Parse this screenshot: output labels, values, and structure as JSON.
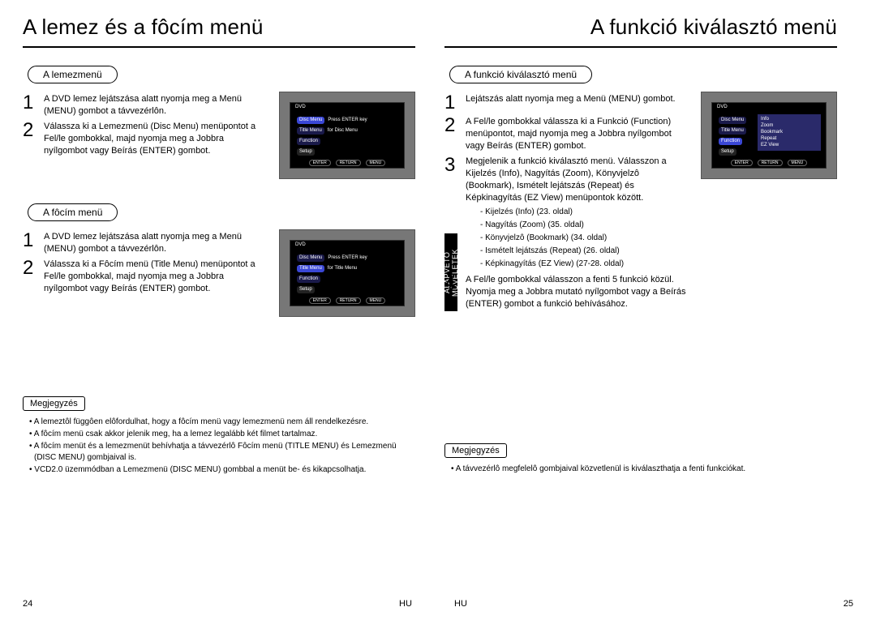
{
  "left": {
    "title": "A lemez és a fôcím menü",
    "discMenu": {
      "label": "A lemezmenü",
      "steps": [
        "A DVD lemez lejátszása alatt nyomja meg a Menü (MENU) gombot a távvezérlôn.",
        "Válassza ki a Lemezmenü (Disc Menu) menüpontot a Fel/le gombokkal, majd nyomja meg a Jobbra nyílgombot vagy Beírás (ENTER) gombot."
      ]
    },
    "titleMenu": {
      "label": "A fôcím menü",
      "steps": [
        "A DVD lemez lejátszása alatt nyomja meg a Menü (MENU) gombot a távvezérlôn.",
        "Válassza ki a Fôcím menü (Title Menu) menüpontot a Fel/le gombokkal, majd nyomja meg a Jobbra nyílgombot vagy Beírás (ENTER) gombot."
      ]
    },
    "osd1": {
      "title": "DVD",
      "items": [
        "Disc Menu",
        "Title Menu",
        "Function",
        "Setup"
      ],
      "hint1": "Press ENTER key",
      "hint2": "for Disc Menu",
      "btns": [
        "ENTER",
        "RETURN",
        "MENU"
      ]
    },
    "osd2": {
      "title": "DVD",
      "items": [
        "Disc Menu",
        "Title Menu",
        "Function",
        "Setup"
      ],
      "hint1": "Press ENTER key",
      "hint2": "for Title Menu",
      "btns": [
        "ENTER",
        "RETURN",
        "MENU"
      ]
    },
    "noteLabel": "Megjegyzés",
    "notes": [
      "• A lemeztôl függôen elôfordulhat, hogy a fôcím menü vagy lemezmenü nem áll rendelkezésre.",
      "• A fôcím menü csak akkor jelenik meg, ha a lemez legalább két filmet tartalmaz.",
      "• A fôcím menüt és a lemezmenüt behívhatja a távvezérlô Fôcím menü (TITLE MENU) és Lemezmenü (DISC MENU) gombjaival is.",
      "• VCD2.0 üzemmódban a Lemezmenü (DISC MENU) gombbal a menüt be- és kikapcsolhatja."
    ],
    "pageNum": "24",
    "lang": "HU"
  },
  "right": {
    "title": "A funkció kiválasztó menü",
    "section": {
      "label": "A funkció kiválasztó menü",
      "steps": [
        "Lejátszás alatt nyomja meg a Menü (MENU) gombot.",
        "A Fel/le gombokkal válassza ki a Funkció (Function) menüpontot, majd nyomja meg a Jobbra nyílgombot vagy Beírás (ENTER) gombot.",
        "Megjelenik a funkció kiválasztó menü. Válasszon a Kijelzés (Info), Nagyítás (Zoom), Könyvjelzô (Bookmark), Ismételt lejátszás (Repeat) és Képkinagyítás (EZ View) menüpontok között.",
        "A Fel/le gombokkal válasszon a fenti 5 funkció közül. Nyomja meg a Jobbra mutató nyílgombot vagy a Beírás (ENTER) gombot a funkció behívásához."
      ],
      "sub": [
        "-  Kijelzés (Info) (23. oldal)",
        "-  Nagyítás (Zoom) (35. oldal)",
        "-  Könyvjelzô (Bookmark) (34. oldal)",
        "-  Ismételt lejátszás (Repeat)  (26. oldal)",
        "-  Képkinagyítás (EZ View) (27-28. oldal)"
      ]
    },
    "osd": {
      "title": "DVD",
      "leftItems": [
        "Disc Menu",
        "Title Menu",
        "Function",
        "Setup"
      ],
      "panel": [
        "Info",
        "Zoom",
        "Bookmark",
        "Repeat",
        "EZ View"
      ],
      "btns": [
        "ENTER",
        "RETURN",
        "MENU"
      ]
    },
    "noteLabel": "Megjegyzés",
    "notes": [
      "• A távvezérlô megfelelô gombjaival közvetlenül is kiválaszthatja a fenti funkciókat."
    ],
    "tab": "ALAPVETO MÛVELETEK",
    "pageNum": "25",
    "lang": "HU"
  }
}
